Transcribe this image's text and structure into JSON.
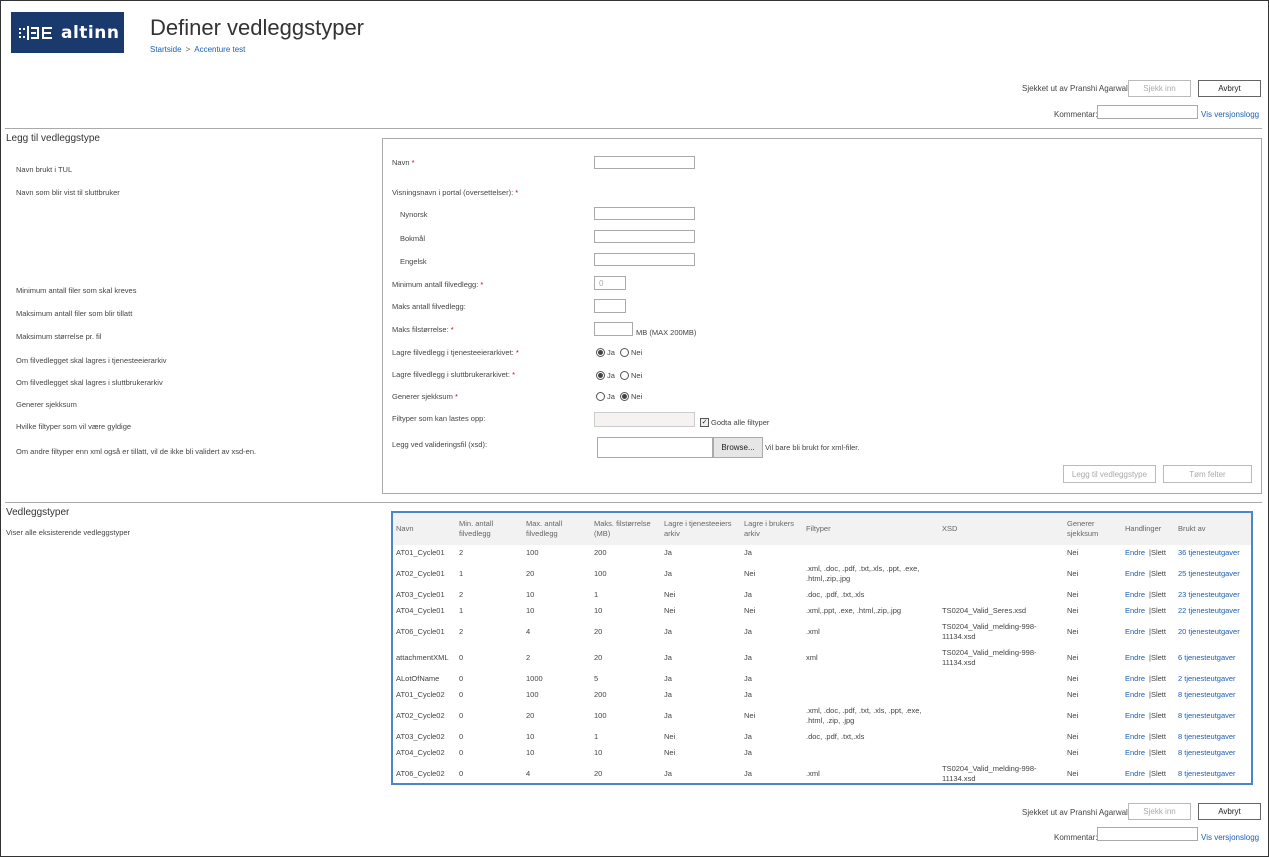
{
  "header": {
    "logo_text": "altinn",
    "page_title": "Definer vedleggstyper",
    "breadcrumb": [
      "Startside",
      "Accenture test"
    ],
    "breadcrumb_sep": ">"
  },
  "checkout_top": {
    "status": "Sjekket ut av Pranshi Agarwal",
    "checkin_label": "Sjekk inn",
    "cancel_label": "Avbryt",
    "comment_label": "Kommentar:",
    "versionlog_label": "Vis versjonslogg"
  },
  "checkout_bottom": {
    "status": "Sjekket ut av Pranshi Agarwal",
    "checkin_label": "Sjekk inn",
    "cancel_label": "Avbryt",
    "comment_label": "Kommentar:",
    "versionlog_label": "Vis versjonslogg"
  },
  "add_section": {
    "title": "Legg til vedleggstype",
    "descriptions": [
      "Navn brukt i TUL",
      "Navn som blir vist til sluttbruker",
      "Minimum antall filer som skal kreves",
      "Maksimum antall filer som blir tillatt",
      "Maksimum størrelse pr. fil",
      "Om filvedlegget skal lagres i tjenesteeierarkiv",
      "Om filvedlegget skal lagres i sluttbrukerarkiv",
      "Generer sjekksum",
      "Hvilke filtyper som vil være gyldige",
      "Om andre filtyper enn xml også er tillatt, vil de ikke bli validert av xsd-en."
    ],
    "form": {
      "name_label": "Navn",
      "display_name_label": "Visningsnavn i portal (oversettelser):",
      "nynorsk_label": "Nynorsk",
      "bokmal_label": "Bokmål",
      "english_label": "Engelsk",
      "min_label": "Minimum antall filvedlegg:",
      "min_placeholder": "0",
      "max_label": "Maks antall filvedlegg:",
      "max_size_label": "Maks filstørrelse:",
      "max_size_hint": "MB (MAX 200MB)",
      "owner_archive_label": "Lagre filvedlegg i tjenesteeierarkivet:",
      "user_archive_label": "Lagre filvedlegg i sluttbrukerarkivet:",
      "checksum_label": "Generer sjekksum",
      "filetypes_label": "Filtyper som kan lastes opp:",
      "accept_all_label": "Godta alle filtyper",
      "xsd_label": "Legg ved valideringsfil (xsd):",
      "browse_label": "Browse...",
      "xsd_hint": "Vil bare bli brukt for xml-filer.",
      "yes": "Ja",
      "no": "Nei",
      "required_mark": "*",
      "add_button": "Legg til vedleggstype",
      "clear_button": "Tøm felter"
    }
  },
  "list_section": {
    "title": "Vedleggstyper",
    "description": "Viser alle eksisterende vedleggstyper",
    "columns": [
      "Navn",
      "Min. antall filvedlegg",
      "Max. antall filvedlegg",
      "Maks. filstørrelse (MB)",
      "Lagre i tjenesteeiers arkiv",
      "Lagre i brukers arkiv",
      "Filtyper",
      "XSD",
      "Generer sjekksum",
      "Handlinger",
      "Brukt av"
    ],
    "edit_label": "Endre",
    "delete_label": "|Slett",
    "rows": [
      {
        "name": "AT01_Cycle01",
        "min": "2",
        "max": "100",
        "size": "200",
        "owner": "Ja",
        "user": "Ja",
        "types": "",
        "xsd": "",
        "checksum": "Nei",
        "used": "36 tjenesteutgaver",
        "tall": false
      },
      {
        "name": "AT02_Cycle01",
        "min": "1",
        "max": "20",
        "size": "100",
        "owner": "Ja",
        "user": "Nei",
        "types": ".xml, .doc, .pdf, .txt,.xls, .ppt, .exe, .html,.zip,.jpg",
        "xsd": "",
        "checksum": "Nei",
        "used": "25 tjenesteutgaver",
        "tall": true
      },
      {
        "name": "AT03_Cycle01",
        "min": "2",
        "max": "10",
        "size": "1",
        "owner": "Nei",
        "user": "Ja",
        "types": ".doc, .pdf, .txt,.xls",
        "xsd": "",
        "checksum": "Nei",
        "used": "23 tjenesteutgaver",
        "tall": false
      },
      {
        "name": "AT04_Cycle01",
        "min": "1",
        "max": "10",
        "size": "10",
        "owner": "Nei",
        "user": "Nei",
        "types": ".xml,.ppt, .exe, .html,.zip,.jpg",
        "xsd": "TS0204_Valid_Seres.xsd",
        "checksum": "Nei",
        "used": "22 tjenesteutgaver",
        "tall": false
      },
      {
        "name": "AT06_Cycle01",
        "min": "2",
        "max": "4",
        "size": "20",
        "owner": "Ja",
        "user": "Ja",
        "types": ".xml",
        "xsd": "TS0204_Valid_melding-998-11134.xsd",
        "checksum": "Nei",
        "used": "20 tjenesteutgaver",
        "tall": true
      },
      {
        "name": "attachmentXML",
        "min": "0",
        "max": "2",
        "size": "20",
        "owner": "Ja",
        "user": "Ja",
        "types": "xml",
        "xsd": "TS0204_Valid_melding-998-11134.xsd",
        "checksum": "Nei",
        "used": "6 tjenesteutgaver",
        "tall": true
      },
      {
        "name": "ALotOfName",
        "min": "0",
        "max": "1000",
        "size": "5",
        "owner": "Ja",
        "user": "Ja",
        "types": "",
        "xsd": "",
        "checksum": "Nei",
        "used": "2 tjenesteutgaver",
        "tall": false
      },
      {
        "name": "AT01_Cycle02",
        "min": "0",
        "max": "100",
        "size": "200",
        "owner": "Ja",
        "user": "Ja",
        "types": "",
        "xsd": "",
        "checksum": "Nei",
        "used": "8 tjenesteutgaver",
        "tall": false
      },
      {
        "name": "AT02_Cycle02",
        "min": "0",
        "max": "20",
        "size": "100",
        "owner": "Ja",
        "user": "Nei",
        "types": ".xml, .doc, .pdf, .txt, .xls, .ppt, .exe, .html, .zip, .jpg",
        "xsd": "",
        "checksum": "Nei",
        "used": "8 tjenesteutgaver",
        "tall": true
      },
      {
        "name": "AT03_Cycle02",
        "min": "0",
        "max": "10",
        "size": "1",
        "owner": "Nei",
        "user": "Ja",
        "types": ".doc, .pdf, .txt,.xls",
        "xsd": "",
        "checksum": "Nei",
        "used": "8 tjenesteutgaver",
        "tall": false
      },
      {
        "name": "AT04_Cycle02",
        "min": "0",
        "max": "10",
        "size": "10",
        "owner": "Nei",
        "user": "Ja",
        "types": "",
        "xsd": "",
        "checksum": "Nei",
        "used": "8 tjenesteutgaver",
        "tall": false
      },
      {
        "name": "AT06_Cycle02",
        "min": "0",
        "max": "4",
        "size": "20",
        "owner": "Ja",
        "user": "Ja",
        "types": ".xml",
        "xsd": "TS0204_Valid_melding-998-11134.xsd",
        "checksum": "Nei",
        "used": "8 tjenesteutgaver",
        "tall": true
      }
    ]
  },
  "colors": {
    "brand": "#1a3a6e",
    "link": "#1a5fb4",
    "table_border": "#4a86c8",
    "required": "#cc0000"
  }
}
